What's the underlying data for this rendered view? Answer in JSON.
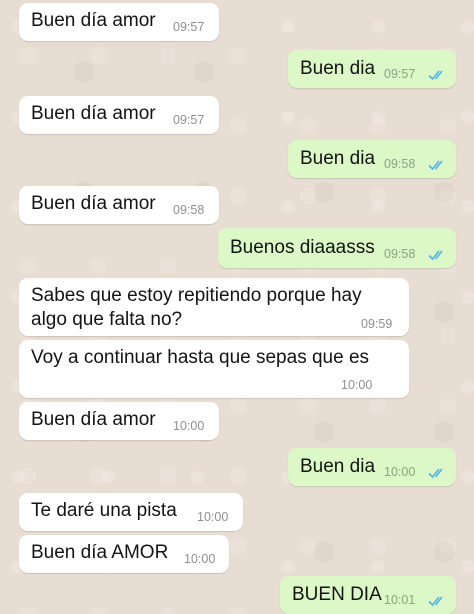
{
  "colors": {
    "wallpaper": "#e8ddd3",
    "incoming_bubble": "#ffffff",
    "outgoing_bubble": "#dcf8c6",
    "read_ticks": "#4fb3e6"
  },
  "messages": [
    {
      "direction": "incoming",
      "text": "Buen día amor",
      "time": "09:57"
    },
    {
      "direction": "outgoing",
      "text": "Buen dia",
      "time": "09:57",
      "status": "read"
    },
    {
      "direction": "incoming",
      "text": "Buen día amor",
      "time": "09:57"
    },
    {
      "direction": "outgoing",
      "text": "Buen dia",
      "time": "09:58",
      "status": "read"
    },
    {
      "direction": "incoming",
      "text": "Buen día amor",
      "time": "09:58"
    },
    {
      "direction": "outgoing",
      "text": "Buenos diaaasss",
      "time": "09:58",
      "status": "read"
    },
    {
      "direction": "incoming",
      "text_line1": "Sabes que estoy repitiendo porque hay",
      "text_line2": "algo que falta no?",
      "time": "09:59"
    },
    {
      "direction": "incoming",
      "text": "Voy a continuar hasta que sepas que es",
      "time": "10:00"
    },
    {
      "direction": "incoming",
      "text": "Buen día amor",
      "time": "10:00"
    },
    {
      "direction": "outgoing",
      "text": "Buen dia",
      "time": "10:00",
      "status": "read"
    },
    {
      "direction": "incoming",
      "text": "Te daré una pista",
      "time": "10:00"
    },
    {
      "direction": "incoming",
      "text": "Buen día AMOR",
      "time": "10:00"
    },
    {
      "direction": "outgoing",
      "text": "BUEN DIA",
      "time": "10:01",
      "status": "read"
    }
  ]
}
